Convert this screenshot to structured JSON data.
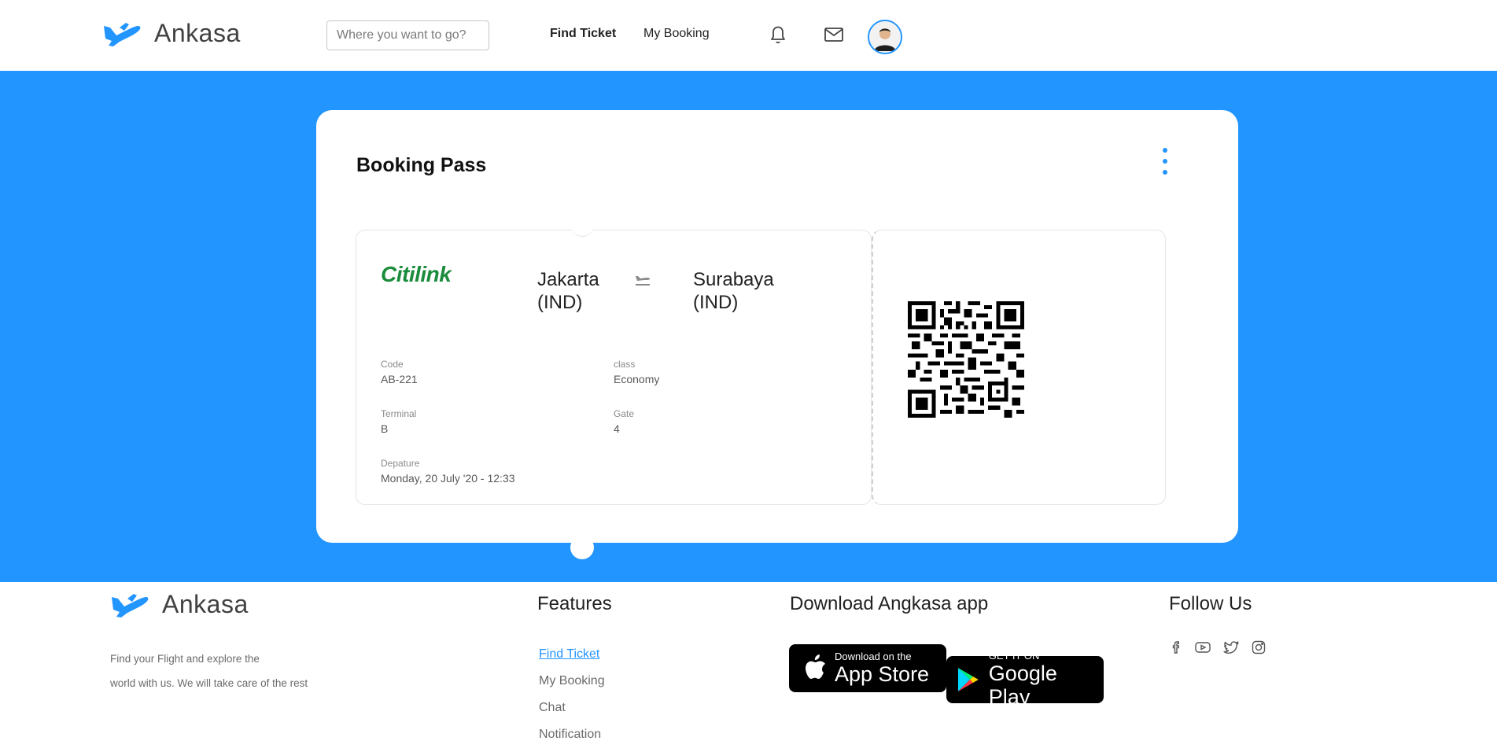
{
  "header": {
    "brand": "Ankasa",
    "search_placeholder": "Where you want to go?",
    "nav": {
      "find_ticket": "Find Ticket",
      "my_booking": "My Booking"
    },
    "icons": {
      "bell": "bell-icon",
      "mail": "mail-icon",
      "avatar": "user-avatar"
    }
  },
  "colors": {
    "primary": "#2395ff",
    "airline": "#1a8c3b"
  },
  "booking": {
    "title": "Booking Pass",
    "airline": "Citilink",
    "from": {
      "city": "Jakarta",
      "country": "(IND)"
    },
    "to": {
      "city": "Surabaya",
      "country": "(IND)"
    },
    "fields": {
      "code_label": "Code",
      "code": "AB-221",
      "class_label": "class",
      "class": "Economy",
      "terminal_label": "Terminal",
      "terminal": "B",
      "gate_label": "Gate",
      "gate": "4",
      "departure_label": "Depature",
      "departure": "Monday, 20 July '20 - 12:33"
    }
  },
  "footer": {
    "brand": "Ankasa",
    "desc_line1": "Find your Flight and explore the",
    "desc_line2": "world with us. We will take care of the rest",
    "features_title": "Features",
    "features": [
      "Find Ticket",
      "My Booking",
      "Chat",
      "Notification"
    ],
    "download_title": "Download Angkasa app",
    "app_store": {
      "small": "Download on the",
      "big": "App Store"
    },
    "google_play": {
      "small": "GET IT ON",
      "big": "Google Play"
    },
    "follow_title": "Follow Us",
    "social": [
      "facebook-icon",
      "youtube-icon",
      "twitter-icon",
      "instagram-icon"
    ]
  }
}
